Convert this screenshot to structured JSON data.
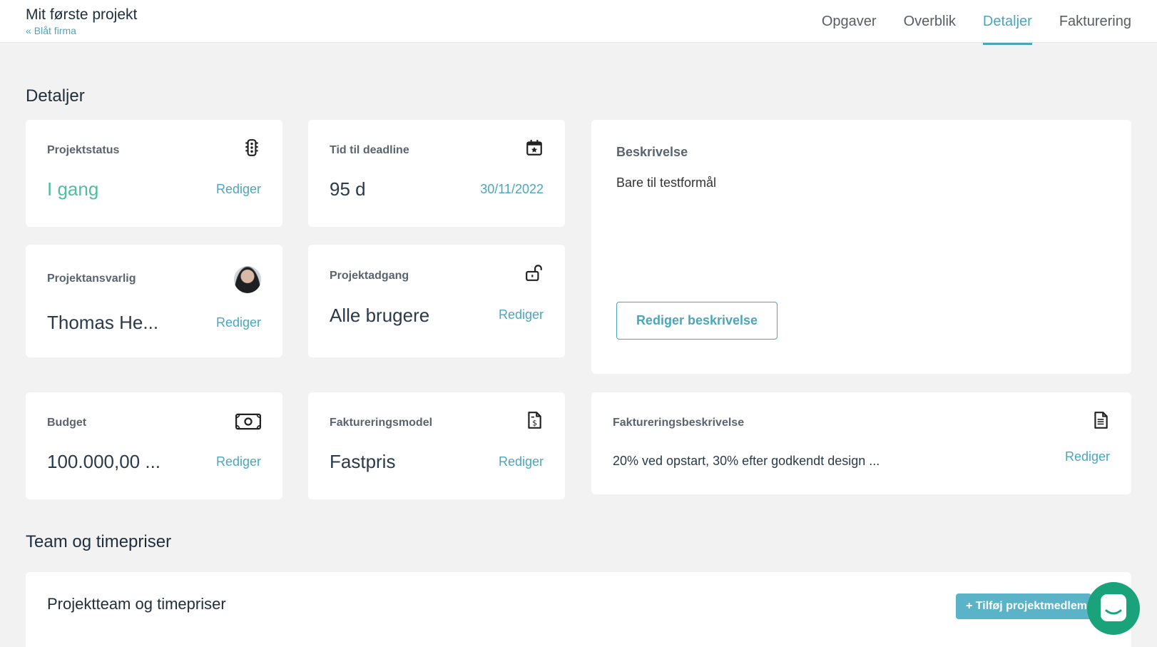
{
  "header": {
    "project_title": "Mit første projekt",
    "back_link": "Blåt firma",
    "tabs": [
      "Opgaver",
      "Overblik",
      "Detaljer",
      "Fakturering"
    ],
    "active_tab": "Detaljer"
  },
  "details": {
    "section_title": "Detaljer",
    "status": {
      "label": "Projektstatus",
      "value": "I gang",
      "edit": "Rediger",
      "icon": "traffic-light-icon"
    },
    "deadline": {
      "label": "Tid til deadline",
      "value": "95 d",
      "date": "30/11/2022",
      "icon": "calendar-star-icon"
    },
    "responsible": {
      "label": "Projektansvarlig",
      "value": "Thomas He...",
      "edit": "Rediger"
    },
    "access": {
      "label": "Projektadgang",
      "value": "Alle brugere",
      "edit": "Rediger",
      "icon": "unlock-icon"
    },
    "budget": {
      "label": "Budget",
      "value": "100.000,00 ...",
      "edit": "Rediger",
      "icon": "money-icon"
    },
    "billing_model": {
      "label": "Faktureringsmodel",
      "value": "Fastpris",
      "edit": "Rediger",
      "icon": "invoice-dollar-icon"
    },
    "description": {
      "label": "Beskrivelse",
      "text": "Bare til testformål",
      "edit_button": "Rediger beskrivelse"
    },
    "billing_description": {
      "label": "Faktureringsbeskrivelse",
      "text": "20% ved opstart, 30% efter godkendt design ...",
      "edit": "Rediger",
      "icon": "document-icon"
    }
  },
  "team": {
    "section_title": "Team og timepriser",
    "card_title": "Projektteam og timepriser",
    "add_button": "+ Tilføj projektmedlem"
  },
  "colors": {
    "accent": "#4aa6bd",
    "status_green": "#4dbf9f",
    "chat": "#1aa37a"
  }
}
